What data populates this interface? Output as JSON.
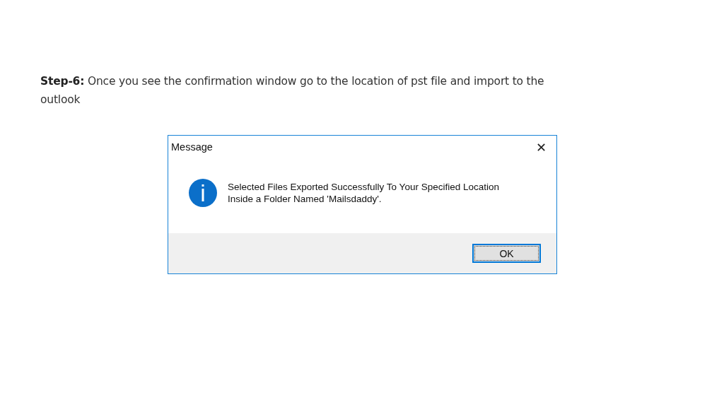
{
  "instruction": "**Step-6:**   Once you see the confirmation window go to the location of pst file and import to the outlook",
  "dialog": {
    "title": "Message",
    "close": "✕",
    "message": [
      "Selected Files Exported Successfully To Your Specified Location",
      "Inside a Folder Named 'Mailsdaddy'."
    ],
    "button": "OK"
  }
}
